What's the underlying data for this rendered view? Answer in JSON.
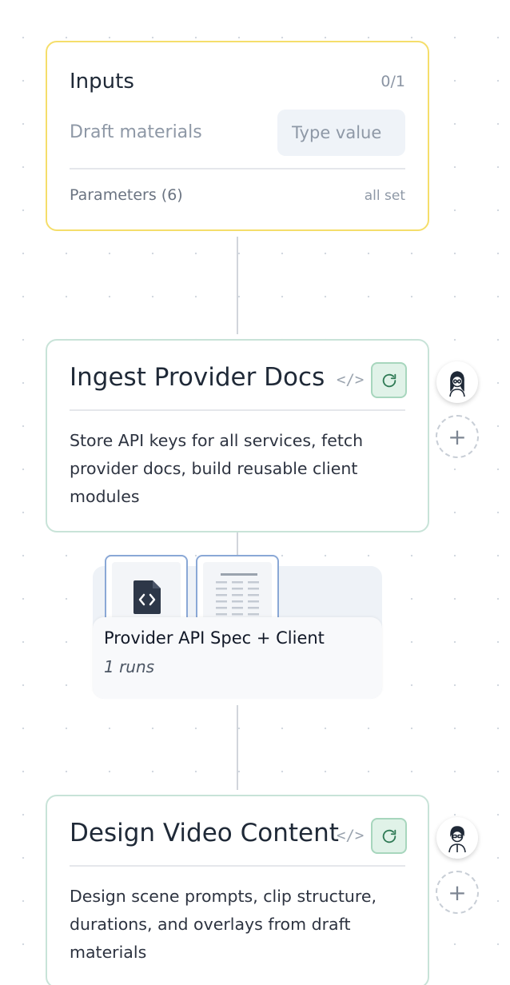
{
  "inputs": {
    "title": "Inputs",
    "count": "0/1",
    "field_label": "Draft materials",
    "field_placeholder": "Type value",
    "field_value": "",
    "parameters_label": "Parameters (6)",
    "parameters_status": "all set"
  },
  "steps": [
    {
      "title": "Ingest Provider Docs",
      "description": "Store API keys for all services, fetch provider docs, build reusable client modules",
      "code_icon": "code-brackets-icon",
      "action_icon": "refresh-icon"
    },
    {
      "title": "Design Video Content",
      "description": "Design scene prompts, clip structure, durations, and overlays from draft materials",
      "code_icon": "code-brackets-icon",
      "action_icon": "refresh-icon"
    }
  ],
  "artifact": {
    "title": "Provider API Spec + Client",
    "runs": "1 runs",
    "thumbnails": [
      "code-file-icon",
      "document-lines-icon"
    ]
  },
  "side_actions": {
    "add_symbol": "+"
  },
  "colors": {
    "inputs_border": "#f5de6b",
    "step_border": "#c8e3d8",
    "refresh_bg": "#e0f2e8",
    "refresh_icon": "#2f7a55",
    "thumb_border": "#8aa8d6"
  }
}
